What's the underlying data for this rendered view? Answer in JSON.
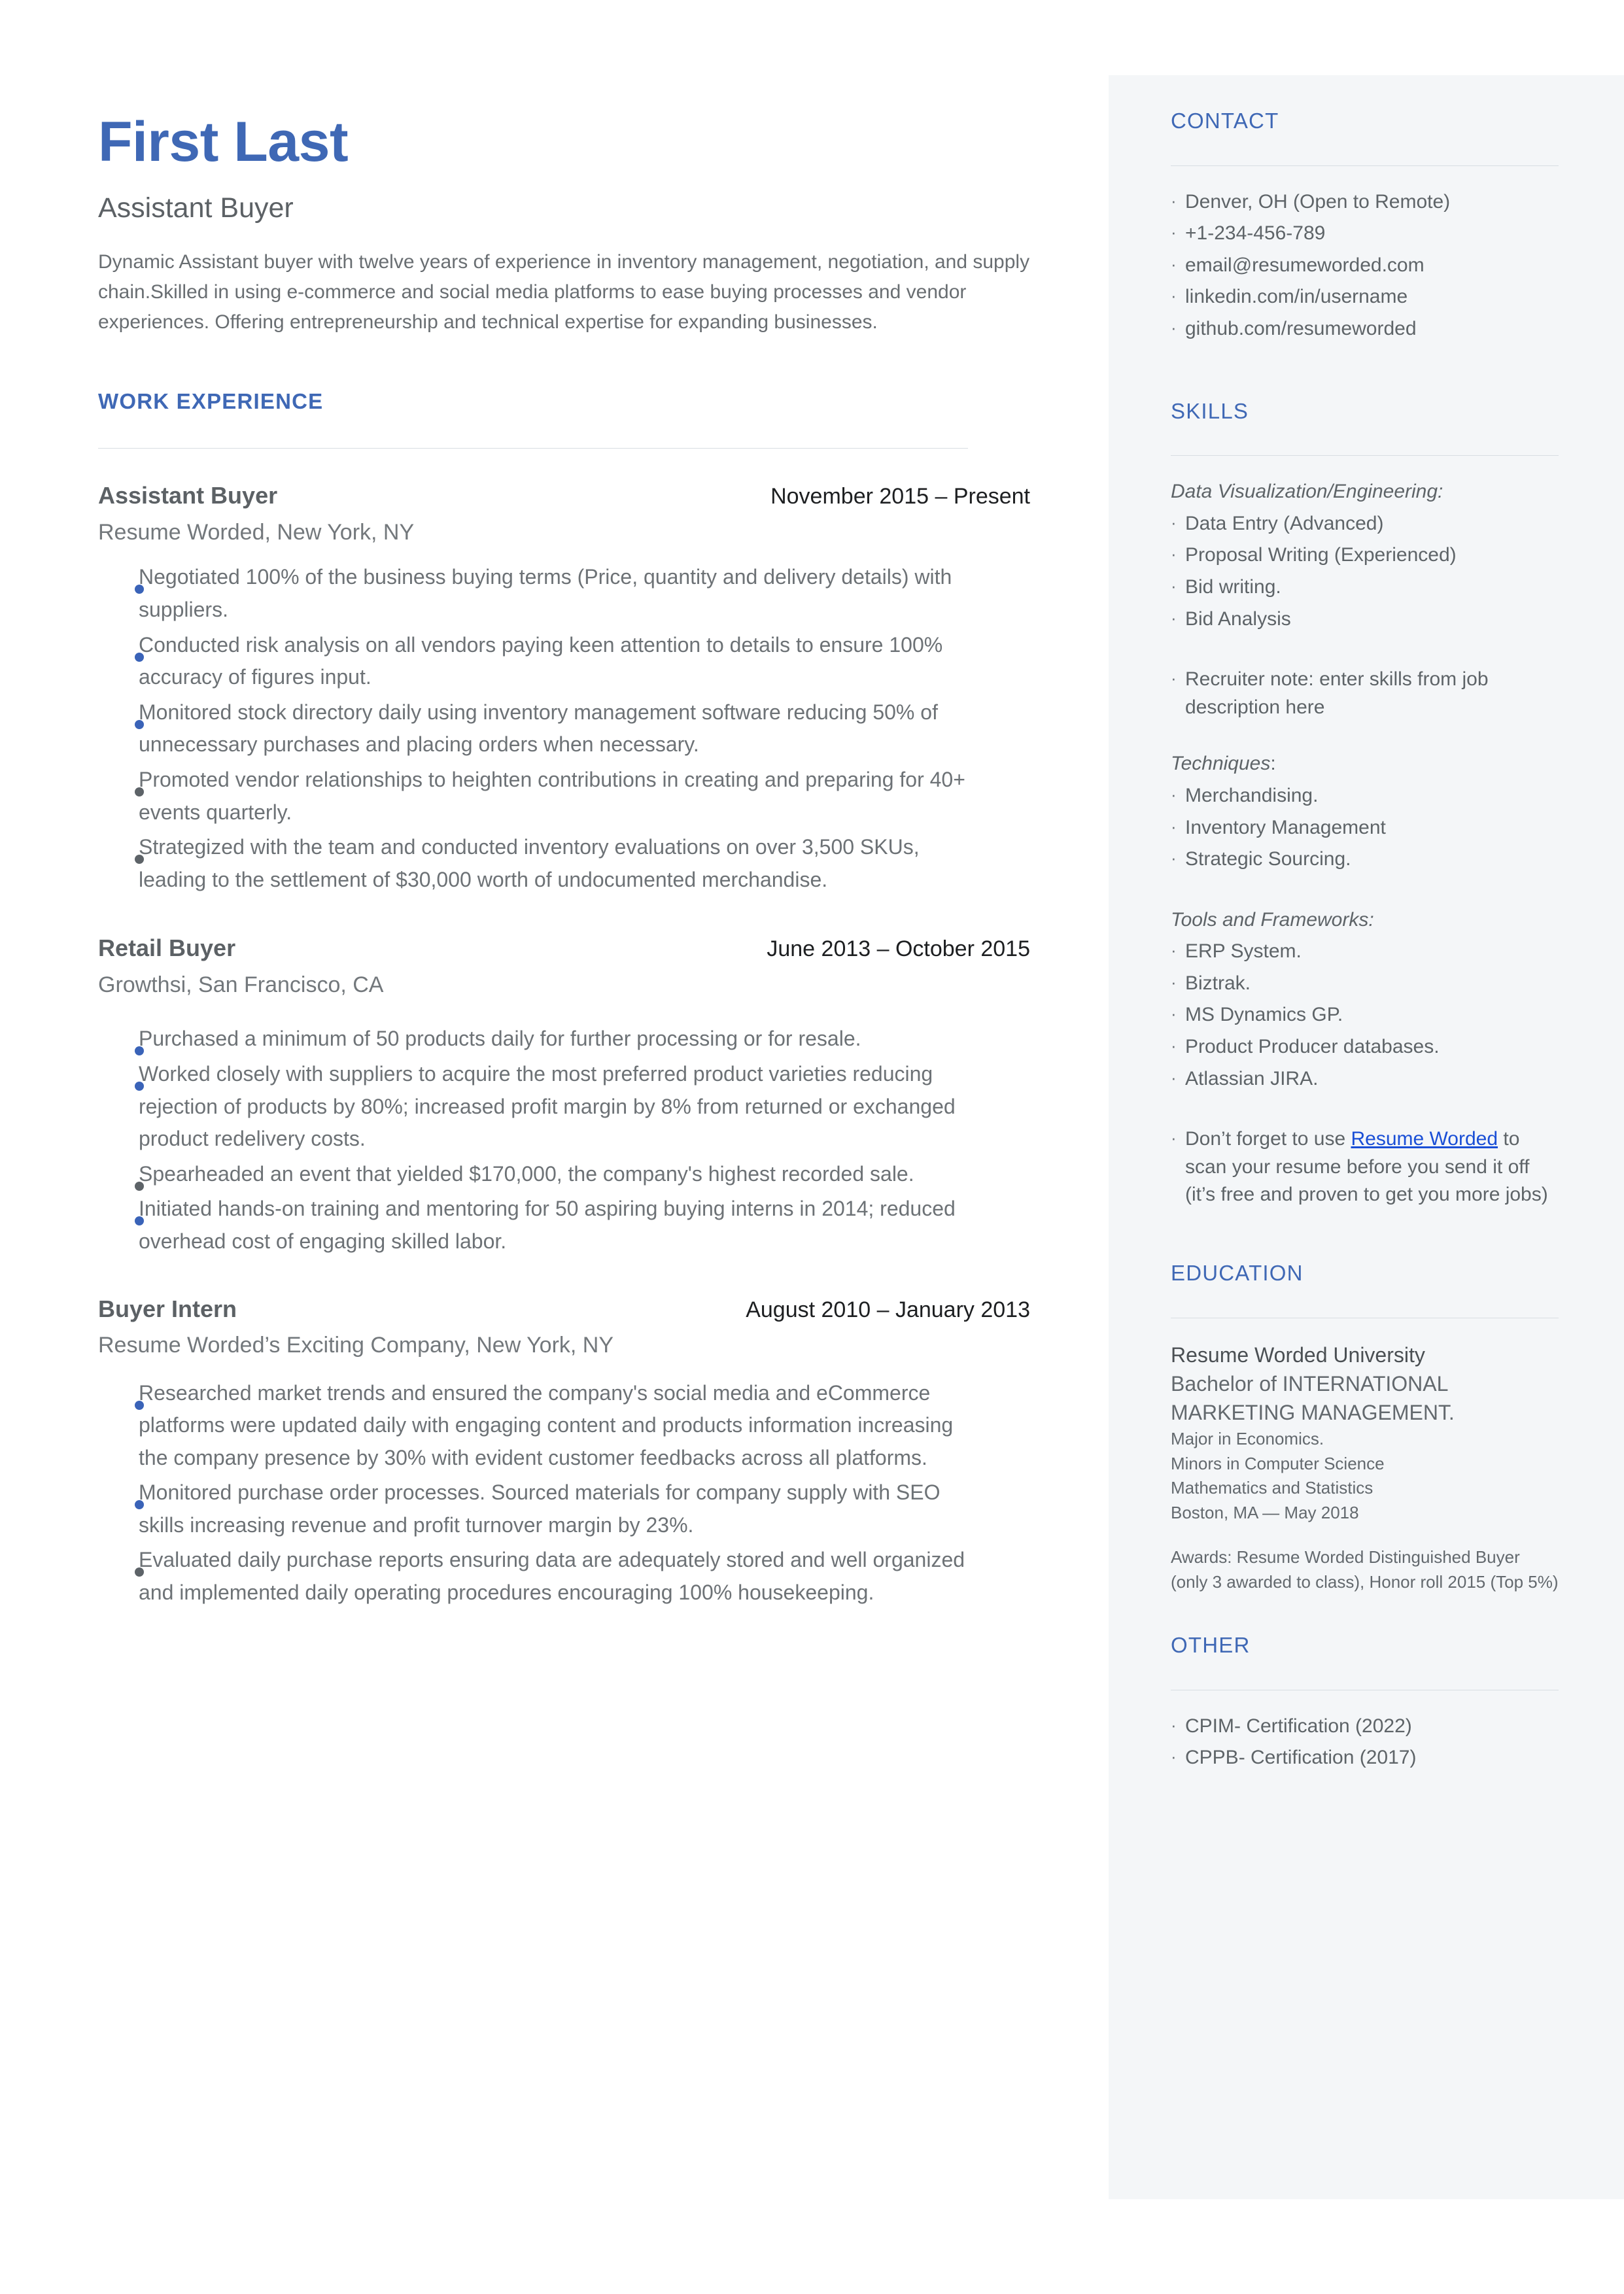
{
  "header": {
    "name": "First Last",
    "title": "Assistant Buyer",
    "summary": "Dynamic Assistant buyer with twelve years of experience in inventory management, negotiation, and supply chain.Skilled in using e-commerce and social media platforms to ease buying processes and vendor experiences. Offering entrepreneurship and technical expertise for expanding businesses."
  },
  "colors": {
    "accent_blue": "#3f68b5",
    "bullet_blue": "#3a63b8",
    "bullet_gray": "#5d6368",
    "body_gray": "#6d7276",
    "sidebar_bg": "#f4f6f8",
    "rule": "#d8dde2",
    "link_blue": "#1a4fd6"
  },
  "main": {
    "work_experience_heading": "WORK EXPERIENCE",
    "jobs": [
      {
        "position": "Assistant Buyer",
        "dates": "November 2015 – Present",
        "organization": "Resume Worded, New York, NY",
        "bullets": [
          {
            "text": "Negotiated 100% of the business buying terms (Price, quantity and delivery details) with suppliers.",
            "marker": "blue"
          },
          {
            "text": "Conducted risk analysis on all vendors paying keen attention to details to ensure 100% accuracy of figures input.",
            "marker": "blue"
          },
          {
            "text": "Monitored stock directory daily using inventory management software reducing 50% of unnecessary purchases and placing orders when necessary.",
            "marker": "blue"
          },
          {
            "text": "Promoted vendor relationships to heighten contributions in creating and preparing for 40+ events quarterly.",
            "marker": "gray"
          },
          {
            "text": "Strategized with the team and conducted inventory evaluations on over 3,500 SKUs, leading to the settlement of $30,000 worth of undocumented merchandise.",
            "marker": "gray"
          }
        ]
      },
      {
        "position": "Retail Buyer",
        "dates": "June 2013 – October 2015",
        "organization": "Growthsi, San Francisco, CA",
        "bullets": [
          {
            "text": "Purchased a minimum of 50 products daily for further processing or for resale.",
            "marker": "blue"
          },
          {
            "text": "Worked closely with suppliers to acquire the most preferred product varieties reducing rejection of products by 80%; increased profit margin by 8% from returned or exchanged product redelivery costs.",
            "marker": "blue"
          },
          {
            "text": "Spearheaded an event that yielded $170,000, the company's highest recorded sale.",
            "marker": "gray"
          },
          {
            "text": "Initiated hands-on training and mentoring for 50 aspiring buying interns in 2014; reduced overhead cost of engaging skilled labor.",
            "marker": "blue"
          }
        ]
      },
      {
        "position": "Buyer Intern",
        "dates": "August 2010 – January 2013",
        "organization": "Resume Worded’s Exciting Company, New York, NY",
        "bullets": [
          {
            "text": "Researched market trends and ensured the company's social media and eCommerce platforms were updated daily with engaging content and products information increasing the company presence by 30% with evident customer feedbacks across all platforms.",
            "marker": "blue"
          },
          {
            "text": "Monitored purchase order processes. Sourced materials for company supply with SEO skills increasing revenue and profit turnover margin by 23%.",
            "marker": "blue"
          },
          {
            "text": "Evaluated daily purchase reports ensuring data are adequately stored and well organized and implemented daily operating procedures encouraging 100% housekeeping.",
            "marker": "gray"
          }
        ]
      }
    ]
  },
  "sidebar": {
    "contact": {
      "heading": "CONTACT",
      "items": [
        "Denver, OH (Open to Remote)",
        "+1-234-456-789",
        "email@resumeworded.com",
        "linkedin.com/in/username",
        "github.com/resumeworded"
      ]
    },
    "skills": {
      "heading": "SKILLS",
      "group1_title": "Data Visualization/Engineering:",
      "group1_items": [
        "Data Entry (Advanced)",
        "Proposal Writing (Experienced)",
        "Bid writing.",
        "Bid Analysis"
      ],
      "recruiter_note": "Recruiter note: enter skills from job description here",
      "group2_title": "Techniques",
      "group2_title_colon": ":",
      "group2_items": [
        "Merchandising.",
        "Inventory Management",
        "Strategic Sourcing."
      ],
      "group3_title": "Tools and Frameworks:",
      "group3_items": [
        "ERP System.",
        "Biztrak.",
        "MS Dynamics GP.",
        "Product Producer databases.",
        "Atlassian JIRA."
      ],
      "promo_prefix": "Don’t forget to use ",
      "promo_link": "Resume Worded",
      "promo_suffix": " to scan your resume before you send it off (it’s free and proven to get you more jobs)"
    },
    "education": {
      "heading": "EDUCATION",
      "school": "Resume Worded University",
      "degree": "Bachelor of INTERNATIONAL MARKETING MANAGEMENT.",
      "major": "Major in Economics.",
      "minor1": "Minors in Computer Science",
      "minor2": "Mathematics and Statistics",
      "location_date": "Boston, MA — May 2018",
      "awards": "Awards: Resume Worded Distinguished Buyer (only 3 awarded to class), Honor roll 2015 (Top 5%)"
    },
    "other": {
      "heading": "OTHER",
      "items": [
        "CPIM- Certification (2022)",
        "CPPB- Certification (2017)"
      ]
    }
  }
}
